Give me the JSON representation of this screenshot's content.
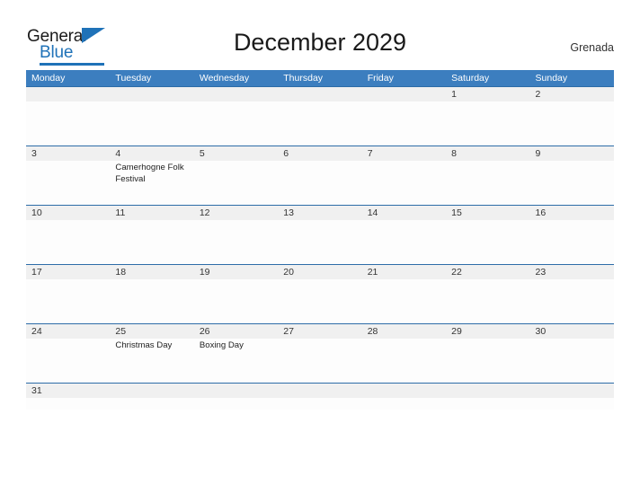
{
  "brand": {
    "name_part1": "General",
    "name_part2": "Blue"
  },
  "header": {
    "title": "December 2029",
    "country": "Grenada"
  },
  "calendar": {
    "weekdays": [
      "Monday",
      "Tuesday",
      "Wednesday",
      "Thursday",
      "Friday",
      "Saturday",
      "Sunday"
    ],
    "colors": {
      "header_bar": "#3c7ebf",
      "row_divider": "#2d6ca8",
      "date_band": "#f0f0f0",
      "brand_blue": "#1f72b8"
    },
    "weeks": [
      [
        {
          "day": "",
          "events": []
        },
        {
          "day": "",
          "events": []
        },
        {
          "day": "",
          "events": []
        },
        {
          "day": "",
          "events": []
        },
        {
          "day": "",
          "events": []
        },
        {
          "day": "1",
          "events": []
        },
        {
          "day": "2",
          "events": []
        }
      ],
      [
        {
          "day": "3",
          "events": []
        },
        {
          "day": "4",
          "events": [
            "Camerhogne Folk Festival"
          ]
        },
        {
          "day": "5",
          "events": []
        },
        {
          "day": "6",
          "events": []
        },
        {
          "day": "7",
          "events": []
        },
        {
          "day": "8",
          "events": []
        },
        {
          "day": "9",
          "events": []
        }
      ],
      [
        {
          "day": "10",
          "events": []
        },
        {
          "day": "11",
          "events": []
        },
        {
          "day": "12",
          "events": []
        },
        {
          "day": "13",
          "events": []
        },
        {
          "day": "14",
          "events": []
        },
        {
          "day": "15",
          "events": []
        },
        {
          "day": "16",
          "events": []
        }
      ],
      [
        {
          "day": "17",
          "events": []
        },
        {
          "day": "18",
          "events": []
        },
        {
          "day": "19",
          "events": []
        },
        {
          "day": "20",
          "events": []
        },
        {
          "day": "21",
          "events": []
        },
        {
          "day": "22",
          "events": []
        },
        {
          "day": "23",
          "events": []
        }
      ],
      [
        {
          "day": "24",
          "events": []
        },
        {
          "day": "25",
          "events": [
            "Christmas Day"
          ]
        },
        {
          "day": "26",
          "events": [
            "Boxing Day"
          ]
        },
        {
          "day": "27",
          "events": []
        },
        {
          "day": "28",
          "events": []
        },
        {
          "day": "29",
          "events": []
        },
        {
          "day": "30",
          "events": []
        }
      ],
      [
        {
          "day": "31",
          "events": []
        },
        {
          "day": "",
          "events": []
        },
        {
          "day": "",
          "events": []
        },
        {
          "day": "",
          "events": []
        },
        {
          "day": "",
          "events": []
        },
        {
          "day": "",
          "events": []
        },
        {
          "day": "",
          "events": []
        }
      ]
    ]
  }
}
